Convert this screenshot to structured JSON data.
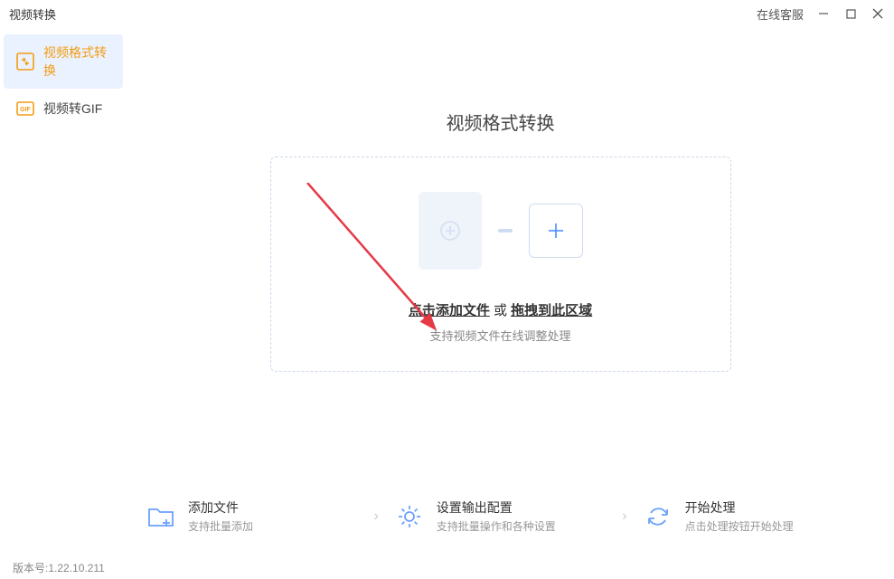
{
  "titlebar": {
    "title": "视频转换",
    "online_service": "在线客服"
  },
  "sidebar": {
    "items": [
      {
        "label": "视频格式转换"
      },
      {
        "label": "视频转GIF"
      }
    ]
  },
  "main": {
    "page_title": "视频格式转换",
    "dropzone": {
      "click_text": "点击添加文件",
      "or_text": " 或 ",
      "drag_text": "拖拽到此区域",
      "subtitle": "支持视频文件在线调整处理"
    }
  },
  "steps": [
    {
      "title": "添加文件",
      "subtitle": "支持批量添加"
    },
    {
      "title": "设置输出配置",
      "subtitle": "支持批量操作和各种设置"
    },
    {
      "title": "开始处理",
      "subtitle": "点击处理按钮开始处理"
    }
  ],
  "footer": {
    "version_label": "版本号:",
    "version": "1.22.10.211"
  }
}
